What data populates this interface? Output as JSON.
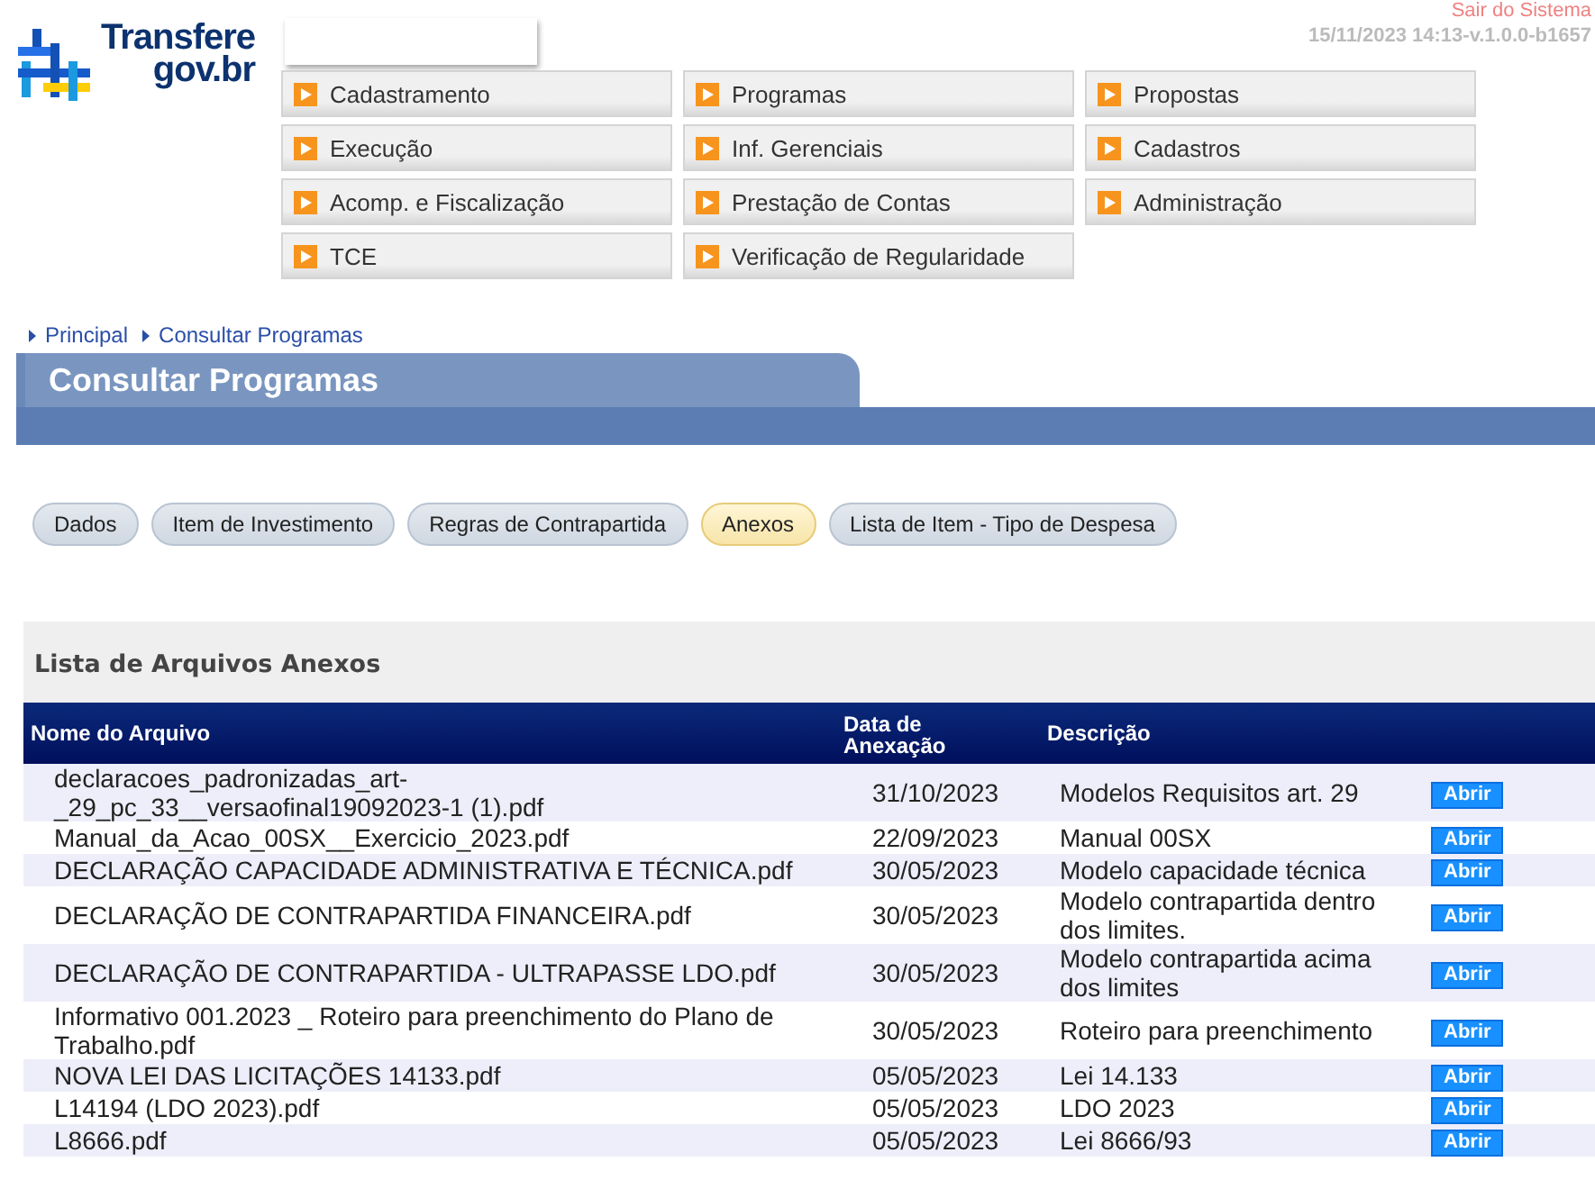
{
  "header": {
    "logo_text_1": "Transfere",
    "logo_text_2": "gov.br",
    "logout": "Sair do Sistema",
    "version": "15/11/2023 14:13-v.1.0.0-b1657"
  },
  "menu": [
    {
      "label": "Cadastramento"
    },
    {
      "label": "Programas"
    },
    {
      "label": "Propostas"
    },
    {
      "label": "Execução"
    },
    {
      "label": "Inf. Gerenciais"
    },
    {
      "label": "Cadastros"
    },
    {
      "label": "Acomp. e Fiscalização"
    },
    {
      "label": "Prestação de Contas"
    },
    {
      "label": "Administração"
    },
    {
      "label": "TCE"
    },
    {
      "label": "Verificação de Regularidade"
    }
  ],
  "breadcrumb": [
    "Principal",
    "Consultar Programas"
  ],
  "page_title": "Consultar Programas",
  "tabs": [
    {
      "label": "Dados",
      "selected": false
    },
    {
      "label": "Item de Investimento",
      "selected": false
    },
    {
      "label": "Regras de Contrapartida",
      "selected": false
    },
    {
      "label": "Anexos",
      "selected": true
    },
    {
      "label": "Lista de Item - Tipo de Despesa",
      "selected": false
    }
  ],
  "section_title": "Lista de Arquivos Anexos",
  "table": {
    "columns": [
      "Nome do Arquivo",
      "Data de Anexação",
      "Descrição"
    ],
    "rows": [
      {
        "file": "declaracoes_padronizadas_art-_29_pc_33__versaofinal19092023-1 (1).pdf",
        "date": "31/10/2023",
        "description": "Modelos Requisitos art. 29",
        "action": "Abrir"
      },
      {
        "file": "Manual_da_Acao_00SX__Exercicio_2023.pdf",
        "date": "22/09/2023",
        "description": "Manual 00SX",
        "action": "Abrir"
      },
      {
        "file": "DECLARAÇÃO CAPACIDADE ADMINISTRATIVA E TÉCNICA.pdf",
        "date": "30/05/2023",
        "description": "Modelo capacidade técnica",
        "action": "Abrir"
      },
      {
        "file": "DECLARAÇÃO DE CONTRAPARTIDA FINANCEIRA.pdf",
        "date": "30/05/2023",
        "description": "Modelo contrapartida dentro dos limites.",
        "action": "Abrir"
      },
      {
        "file": "DECLARAÇÃO DE CONTRAPARTIDA - ULTRAPASSE LDO.pdf",
        "date": "30/05/2023",
        "description": "Modelo contrapartida acima dos limites",
        "action": "Abrir"
      },
      {
        "file": "Informativo 001.2023 _ Roteiro para preenchimento do Plano de Trabalho.pdf",
        "date": "30/05/2023",
        "description": "Roteiro para preenchimento",
        "action": "Abrir"
      },
      {
        "file": "NOVA LEI DAS LICITAÇÕES 14133.pdf",
        "date": "05/05/2023",
        "description": "Lei 14.133",
        "action": "Abrir"
      },
      {
        "file": "L14194 (LDO 2023).pdf",
        "date": "05/05/2023",
        "description": "LDO 2023",
        "action": "Abrir"
      },
      {
        "file": "L8666.pdf",
        "date": "05/05/2023",
        "description": "Lei 8666/93",
        "action": "Abrir"
      }
    ]
  }
}
